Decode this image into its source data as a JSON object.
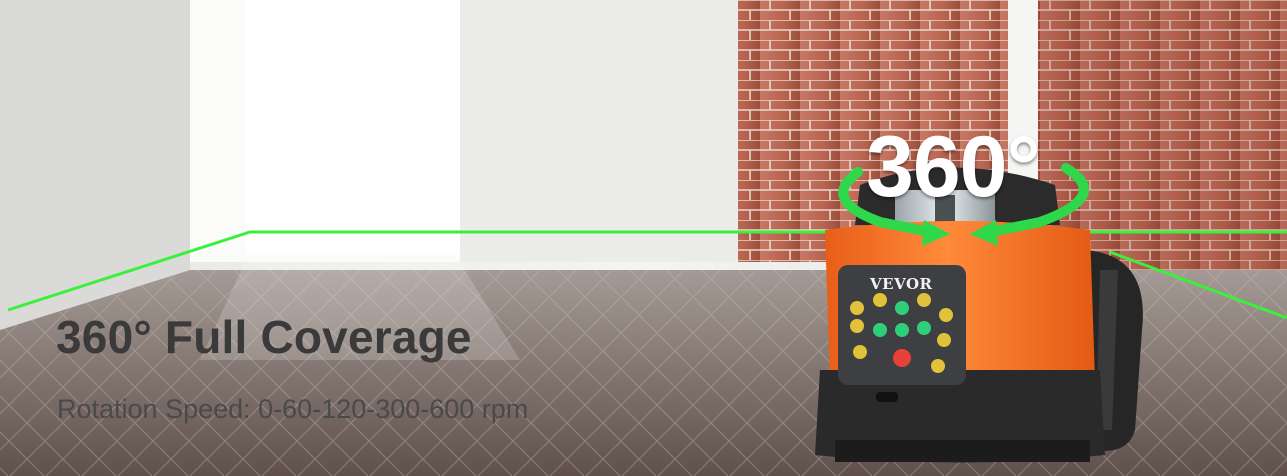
{
  "banner": {
    "headline": "360° Full Coverage",
    "subline": "Rotation Speed: 0-60-120-300-600 rpm",
    "badge": "360°"
  },
  "product": {
    "brand": "VEVOR",
    "body_color": "#f36d1f",
    "grip_color": "#2b2b2b",
    "panel_color": "#3d3f42"
  },
  "colors": {
    "laser_line": "#3bf03a",
    "rotation_arrow": "#2fd84a",
    "brick": "#b5614b",
    "floor": "#7a6a64",
    "wall": "#eeeeec"
  }
}
